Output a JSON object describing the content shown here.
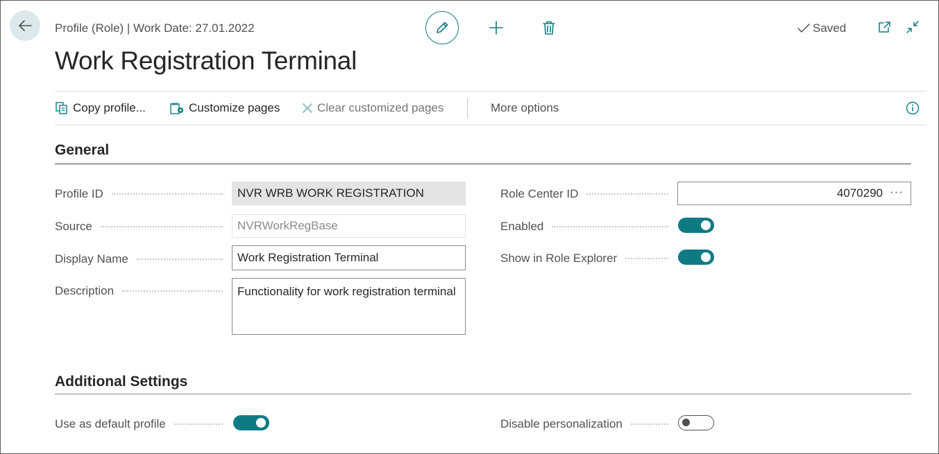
{
  "header": {
    "caption": "Profile (Role) | Work Date: 27.01.2022",
    "title": "Work Registration Terminal",
    "saved_label": "Saved",
    "icons": [
      "back-arrow-icon",
      "pencil-icon",
      "plus-icon",
      "trash-icon",
      "checkmark-icon",
      "pop-out-icon",
      "collapse-icon"
    ]
  },
  "actions": {
    "copy_profile": "Copy profile...",
    "customize_pages": "Customize pages",
    "clear_customized_pages": "Clear customized pages",
    "more_options": "More options"
  },
  "general": {
    "title": "General",
    "profile_id": {
      "label": "Profile ID",
      "value": "NVR WRB WORK REGISTRATION"
    },
    "source": {
      "label": "Source",
      "value": "NVRWorkRegBase"
    },
    "display_name": {
      "label": "Display Name",
      "value": "Work Registration Terminal"
    },
    "description": {
      "label": "Description",
      "value": "Functionality for work registration terminal"
    },
    "role_center_id": {
      "label": "Role Center ID",
      "value": "4070290",
      "lookup": "···"
    },
    "enabled": {
      "label": "Enabled",
      "value": true
    },
    "show_in_role_explorer": {
      "label": "Show in Role Explorer",
      "value": true
    }
  },
  "additional": {
    "title": "Additional Settings",
    "use_as_default_profile": {
      "label": "Use as default profile",
      "value": true
    },
    "disable_personalization": {
      "label": "Disable personalization",
      "value": false
    }
  },
  "colors": {
    "accent": "#0e7b84",
    "back_button_bg": "#dbe9ec",
    "readonly_bg": "#e4e4e4"
  }
}
